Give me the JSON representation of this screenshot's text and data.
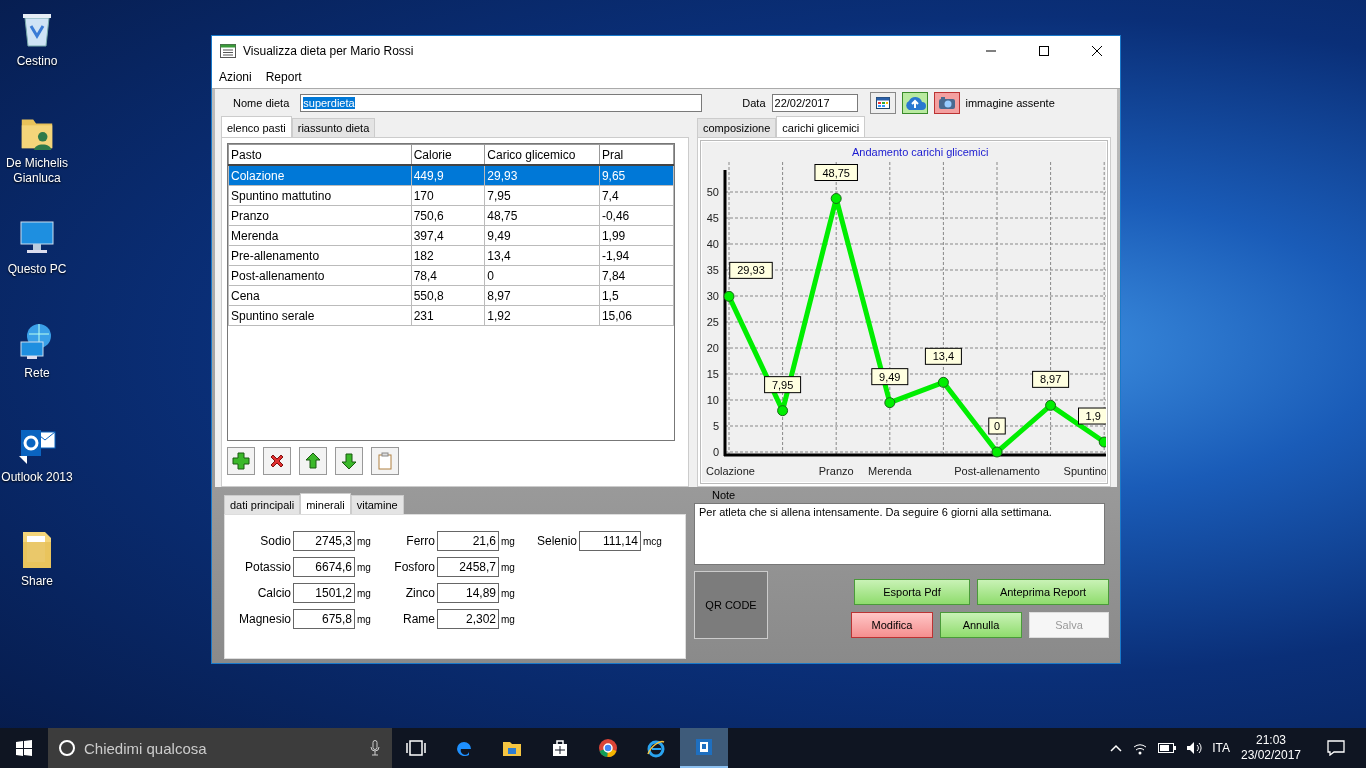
{
  "desktop_icons": [
    {
      "label": "Cestino",
      "kind": "trash"
    },
    {
      "label": "De Michelis Gianluca",
      "kind": "user"
    },
    {
      "label": "Questo PC",
      "kind": "pc"
    },
    {
      "label": "Rete",
      "kind": "network"
    },
    {
      "label": "Outlook 2013",
      "kind": "mail"
    },
    {
      "label": "Share",
      "kind": "folder"
    }
  ],
  "window": {
    "title": "Visualizza dieta per Mario Rossi"
  },
  "menu": [
    "Azioni",
    "Report"
  ],
  "diet_name": {
    "label": "Nome dieta",
    "value": "superdieta"
  },
  "date": {
    "label": "Data",
    "value": "22/02/2017"
  },
  "image_status": "immagine assente",
  "meal_tabs": [
    {
      "label": "elenco pasti",
      "selected": true
    },
    {
      "label": "riassunto dieta",
      "selected": false
    }
  ],
  "meals_table": {
    "columns": [
      "Pasto",
      "Calorie",
      "Carico glicemico",
      "Pral"
    ],
    "rows": [
      {
        "cells": [
          "Colazione",
          "449,9",
          "29,93",
          "9,65"
        ],
        "selected": true
      },
      {
        "cells": [
          "Spuntino mattutino",
          "170",
          "7,95",
          "7,4"
        ],
        "selected": false
      },
      {
        "cells": [
          "Pranzo",
          "750,6",
          "48,75",
          "-0,46"
        ],
        "selected": false
      },
      {
        "cells": [
          "Merenda",
          "397,4",
          "9,49",
          "1,99"
        ],
        "selected": false
      },
      {
        "cells": [
          "Pre-allenamento",
          "182",
          "13,4",
          "-1,94"
        ],
        "selected": false
      },
      {
        "cells": [
          "Post-allenamento",
          "78,4",
          "0",
          "7,84"
        ],
        "selected": false
      },
      {
        "cells": [
          "Cena",
          "550,8",
          "8,97",
          "1,5"
        ],
        "selected": false
      },
      {
        "cells": [
          "Spuntino serale",
          "231",
          "1,92",
          "15,06"
        ],
        "selected": false
      }
    ]
  },
  "table_tools": [
    {
      "kind": "add"
    },
    {
      "kind": "delete"
    },
    {
      "kind": "up"
    },
    {
      "kind": "down"
    },
    {
      "kind": "clipboard"
    }
  ],
  "chart_tabs": [
    {
      "label": "composizione",
      "selected": false
    },
    {
      "label": "carichi glicemici",
      "selected": true
    }
  ],
  "chart": {
    "chart_data": {
      "type": "line",
      "title": "Andamento carichi glicemici",
      "ylim": [
        0,
        50
      ],
      "yticks": [
        0,
        5,
        10,
        15,
        20,
        25,
        30,
        35,
        40,
        45,
        50
      ],
      "categories": [
        "Colazione",
        null,
        "Pranzo",
        "Merenda",
        null,
        "Post-allenamento",
        null,
        "Spuntino"
      ],
      "grid": true,
      "series": [
        {
          "color": "#00ee00",
          "marker": "circle",
          "values": [
            29.93,
            7.95,
            48.75,
            9.49,
            13.4,
            0,
            8.97,
            1.92
          ]
        }
      ],
      "value_labels": [
        "29,93",
        "7,95",
        "48,75",
        "9,49",
        "13,4",
        "0",
        "8,97",
        "1,9"
      ]
    }
  },
  "detail_tabs": [
    {
      "label": "dati principali",
      "selected": false
    },
    {
      "label": "minerali",
      "selected": true
    },
    {
      "label": "vitamine",
      "selected": false
    }
  ],
  "minerals": [
    [
      {
        "label": "Sodio",
        "value": "2745,3",
        "unit": "mg"
      },
      {
        "label": "Potassio",
        "value": "6674,6",
        "unit": "mg"
      },
      {
        "label": "Calcio",
        "value": "1501,2",
        "unit": "mg"
      },
      {
        "label": "Magnesio",
        "value": "675,8",
        "unit": "mg"
      }
    ],
    [
      {
        "label": "Ferro",
        "value": "21,6",
        "unit": "mg"
      },
      {
        "label": "Fosforo",
        "value": "2458,7",
        "unit": "mg"
      },
      {
        "label": "Zinco",
        "value": "14,89",
        "unit": "mg"
      },
      {
        "label": "Rame",
        "value": "2,302",
        "unit": "mg"
      }
    ],
    [
      {
        "label": "Selenio",
        "value": "111,14",
        "unit": "mcg"
      }
    ]
  ],
  "notes": {
    "label": "Note",
    "value": "Per atleta che si allena intensamente. Da seguire 6 giorni alla settimana."
  },
  "qr_code": "QR CODE",
  "buttons": [
    [
      {
        "label": "Esporta Pdf",
        "kind": "confirm",
        "disabled": false
      },
      {
        "label": "Anteprima Report",
        "kind": "confirm",
        "disabled": false
      }
    ],
    [
      {
        "label": "Modifica",
        "kind": "danger",
        "disabled": false
      },
      {
        "label": "Annulla",
        "kind": "confirm",
        "disabled": false
      },
      {
        "label": "Salva",
        "kind": "confirm",
        "disabled": true
      }
    ]
  ],
  "taskbar": {
    "search_placeholder": "Chiedimi qualcosa",
    "apps": [
      {
        "kind": "taskview",
        "selected": false
      },
      {
        "kind": "edge",
        "selected": false
      },
      {
        "kind": "explorer",
        "selected": false
      },
      {
        "kind": "store",
        "selected": false
      },
      {
        "kind": "chrome",
        "selected": false
      },
      {
        "kind": "ie",
        "selected": false
      },
      {
        "kind": "dietapp",
        "selected": true
      }
    ],
    "language": "ITA",
    "time": "21:03",
    "date": "23/02/2017"
  }
}
